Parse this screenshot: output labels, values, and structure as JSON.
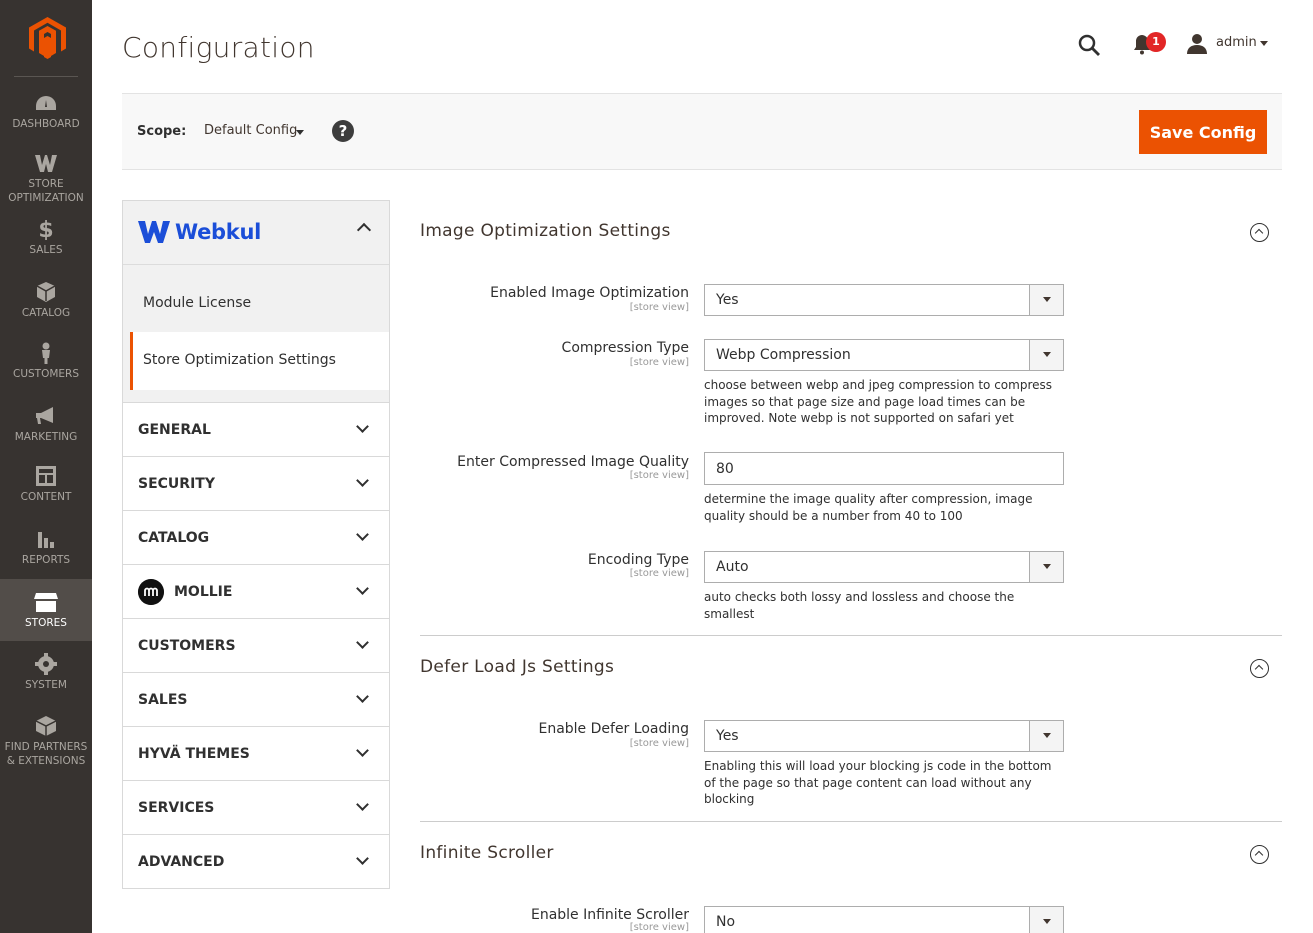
{
  "sidebar": {
    "items": [
      {
        "label": "DASHBOARD",
        "icon": "dashboard-icon"
      },
      {
        "label": "STORE\nOPTIMIZATION",
        "icon": "webkul-w-icon"
      },
      {
        "label": "SALES",
        "icon": "dollar-icon"
      },
      {
        "label": "CATALOG",
        "icon": "box-icon"
      },
      {
        "label": "CUSTOMERS",
        "icon": "person-icon"
      },
      {
        "label": "MARKETING",
        "icon": "megaphone-icon"
      },
      {
        "label": "CONTENT",
        "icon": "layout-icon"
      },
      {
        "label": "REPORTS",
        "icon": "bar-chart-icon"
      },
      {
        "label": "STORES",
        "icon": "storefront-icon",
        "active": true
      },
      {
        "label": "SYSTEM",
        "icon": "gear-icon"
      },
      {
        "label": "FIND PARTNERS\n& EXTENSIONS",
        "icon": "cube-icon"
      }
    ]
  },
  "header": {
    "title": "Configuration",
    "notifications_count": "1",
    "user": "admin"
  },
  "scope": {
    "label": "Scope:",
    "value": "Default Config",
    "help": "?",
    "save_label": "Save Config"
  },
  "tabs": {
    "brand": "Webkul",
    "sub_items": [
      "Module License",
      "Store Optimization Settings"
    ],
    "sections": [
      "GENERAL",
      "SECURITY",
      "CATALOG",
      "MOLLIE",
      "CUSTOMERS",
      "SALES",
      "HYVÄ THEMES",
      "SERVICES",
      "ADVANCED"
    ]
  },
  "main": {
    "scope_hint": "[store view]",
    "image_opt": {
      "title": "Image Optimization Settings",
      "enabled_label": "Enabled Image Optimization",
      "enabled_value": "Yes",
      "compression_label": "Compression Type",
      "compression_value": "Webp Compression",
      "compression_note": "choose between webp and jpeg compression to compress images so that page size and page load times can be improved. Note webp is not supported on safari yet",
      "quality_label": "Enter Compressed Image Quality",
      "quality_value": "80",
      "quality_note": "determine the image quality after compression, image quality should be a number from 40 to 100",
      "encoding_label": "Encoding Type",
      "encoding_value": "Auto",
      "encoding_note": "auto checks both lossy and lossless and choose the smallest"
    },
    "defer": {
      "title": "Defer Load Js Settings",
      "enable_label": "Enable Defer Loading",
      "enable_value": "Yes",
      "enable_note": "Enabling this will load your blocking js code in the bottom of the page so that page content can load without any blocking"
    },
    "infinite": {
      "title": "Infinite Scroller",
      "enable_label": "Enable Infinite Scroller",
      "enable_value": "No"
    }
  },
  "colors": {
    "sidebar_bg": "#373330",
    "accent": "#eb5202",
    "webkul_blue": "#1b4ed8",
    "badge": "#e22626"
  }
}
